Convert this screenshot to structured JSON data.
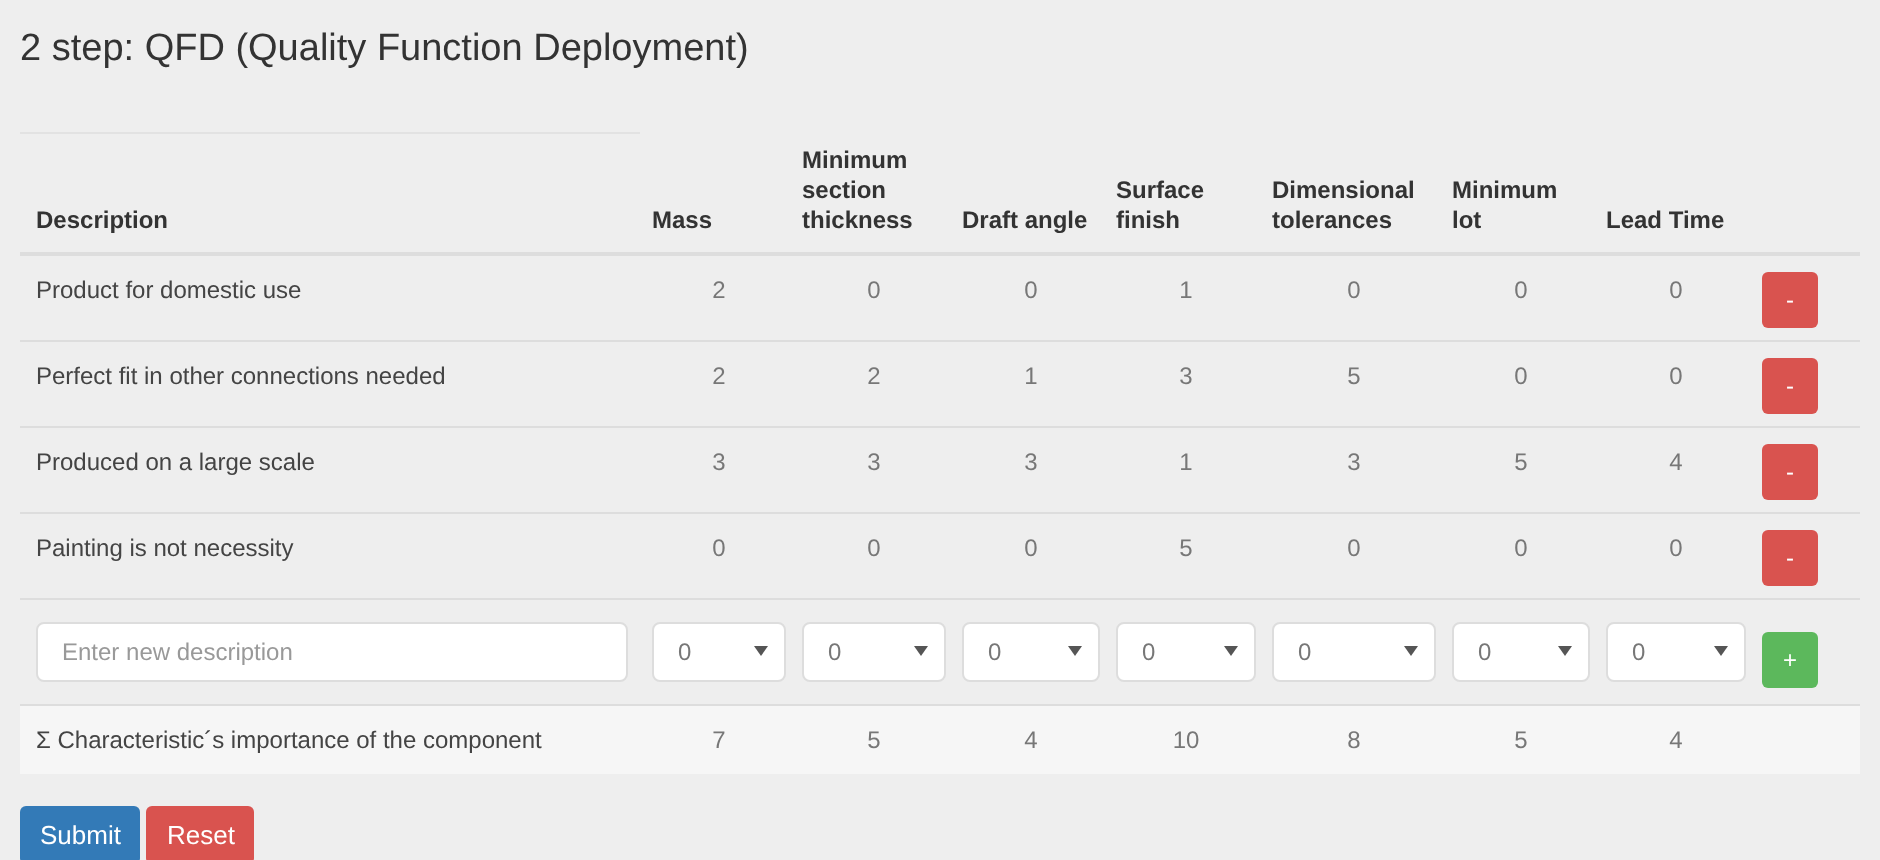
{
  "title": "2 step: QFD (Quality Function Deployment)",
  "columns": [
    "Description",
    "Mass",
    "Minimum section thickness",
    "Draft angle",
    "Surface finish",
    "Dimensional tolerances",
    "Minimum lot",
    "Lead Time"
  ],
  "rows": [
    {
      "description": "Product for domestic use",
      "values": [
        "2",
        "0",
        "0",
        "1",
        "0",
        "0",
        "0"
      ],
      "remove": "-"
    },
    {
      "description": "Perfect fit in other connections needed",
      "values": [
        "2",
        "2",
        "1",
        "3",
        "5",
        "0",
        "0"
      ],
      "remove": "-"
    },
    {
      "description": "Produced on a large scale",
      "values": [
        "3",
        "3",
        "3",
        "1",
        "3",
        "5",
        "4"
      ],
      "remove": "-"
    },
    {
      "description": "Painting is not necessity",
      "values": [
        "0",
        "0",
        "0",
        "5",
        "0",
        "0",
        "0"
      ],
      "remove": "-"
    }
  ],
  "new_row": {
    "placeholder": "Enter new description",
    "selects": [
      "0",
      "0",
      "0",
      "0",
      "0",
      "0",
      "0"
    ],
    "add": "+"
  },
  "totals": {
    "label": "Σ Characteristic´s importance of the component",
    "values": [
      "7",
      "5",
      "4",
      "10",
      "8",
      "5",
      "4"
    ]
  },
  "buttons": [
    {
      "label": "Submit",
      "kind": "primary"
    },
    {
      "label": "Reset",
      "kind": "danger"
    }
  ]
}
